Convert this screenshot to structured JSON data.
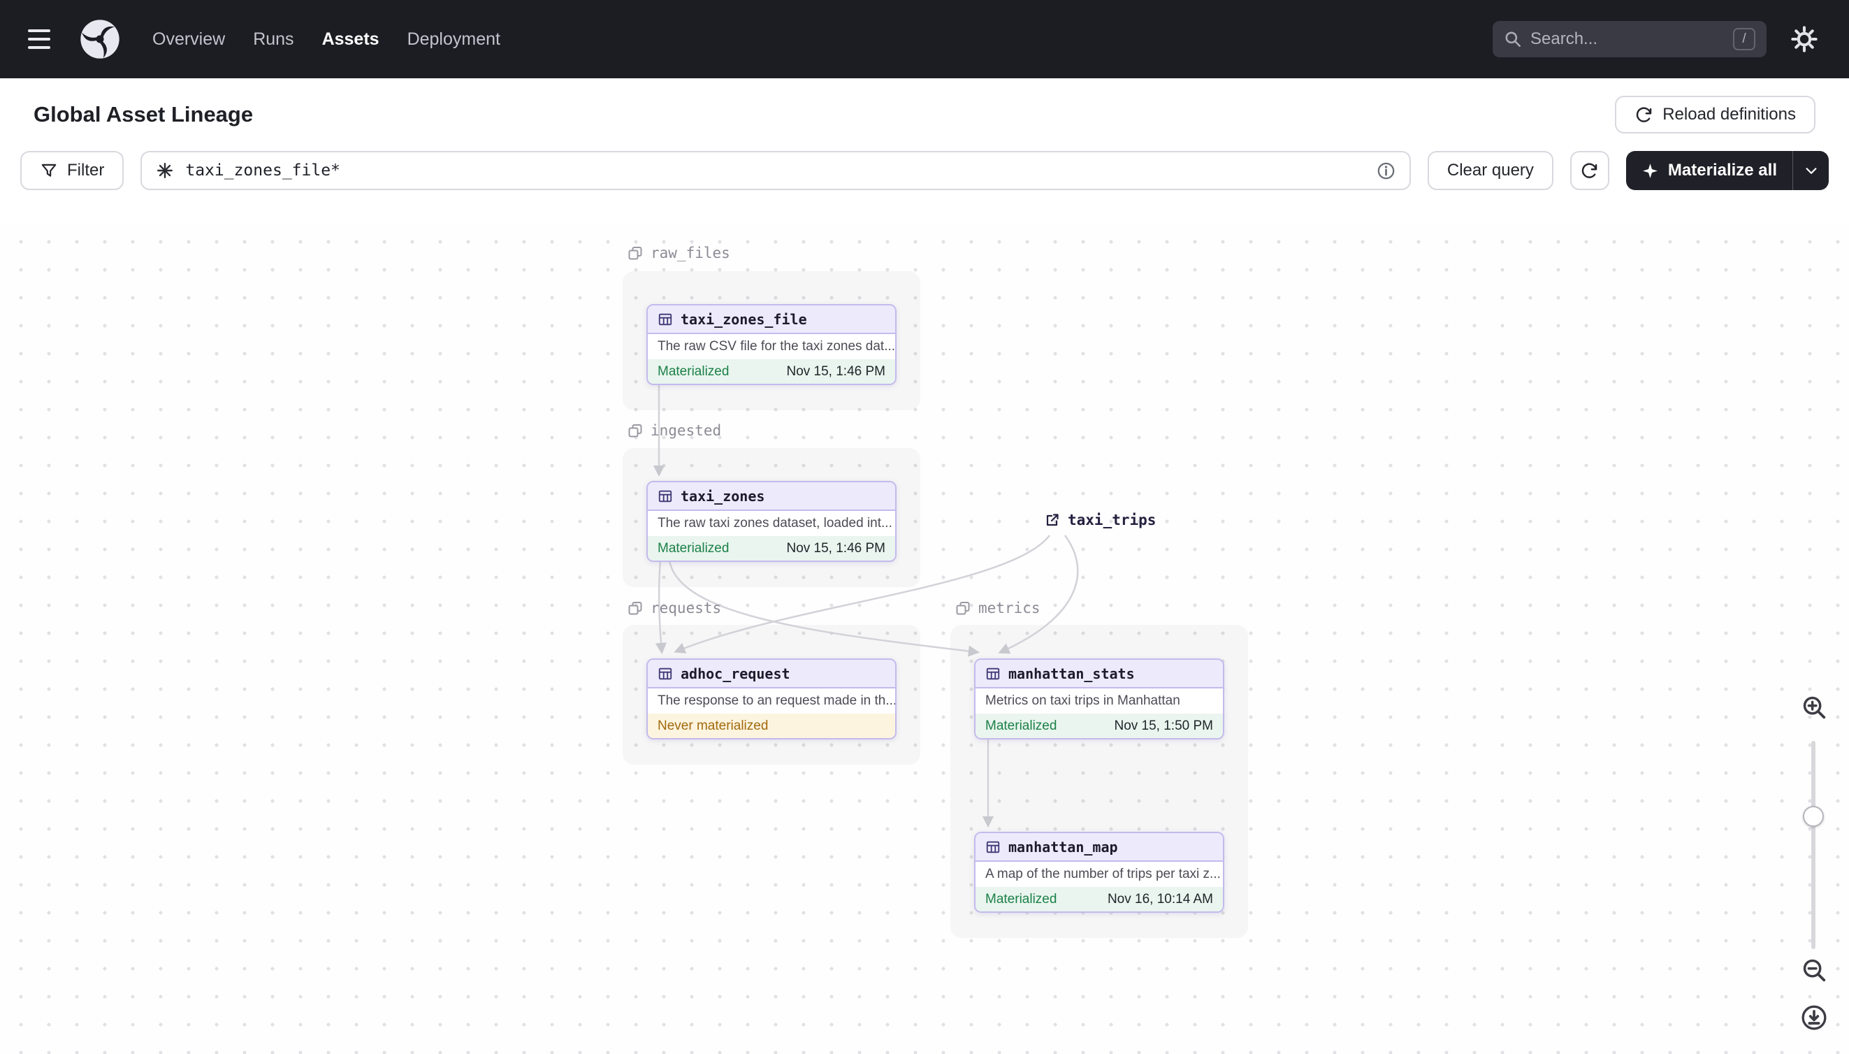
{
  "nav": {
    "items": [
      {
        "label": "Overview"
      },
      {
        "label": "Runs"
      },
      {
        "label": "Assets"
      },
      {
        "label": "Deployment"
      }
    ],
    "search_placeholder": "Search...",
    "search_shortcut": "/"
  },
  "header": {
    "title": "Global Asset Lineage",
    "reload_button": "Reload definitions"
  },
  "toolbar": {
    "filter_label": "Filter",
    "query_value": "taxi_zones_file*",
    "clear_query_label": "Clear query",
    "materialize_label": "Materialize all"
  },
  "graph": {
    "groups": [
      {
        "name": "raw_files"
      },
      {
        "name": "ingested"
      },
      {
        "name": "requests"
      },
      {
        "name": "metrics"
      }
    ],
    "nodes": [
      {
        "name": "taxi_zones_file",
        "description": "The raw CSV file for the taxi zones dat...",
        "status": "Materialized",
        "timestamp": "Nov 15, 1:46 PM"
      },
      {
        "name": "taxi_zones",
        "description": "The raw taxi zones dataset, loaded int...",
        "status": "Materialized",
        "timestamp": "Nov 15, 1:46 PM"
      },
      {
        "name": "adhoc_request",
        "description": "The response to an request made in th...",
        "status": "Never materialized",
        "timestamp": ""
      },
      {
        "name": "manhattan_stats",
        "description": "Metrics on taxi trips in Manhattan",
        "status": "Materialized",
        "timestamp": "Nov 15, 1:50 PM"
      },
      {
        "name": "manhattan_map",
        "description": "A map of the number of trips per taxi z...",
        "status": "Materialized",
        "timestamp": "Nov 16, 10:14 AM"
      }
    ],
    "external_node": {
      "name": "taxi_trips"
    }
  },
  "colors": {
    "nav-bg": "#1c1c23",
    "dark-btn": "#202028",
    "node-border": "#c4baed",
    "materialized-green": "#1c8048",
    "warning-amber": "#a3690b",
    "edge-gray": "#d2d2d8"
  }
}
